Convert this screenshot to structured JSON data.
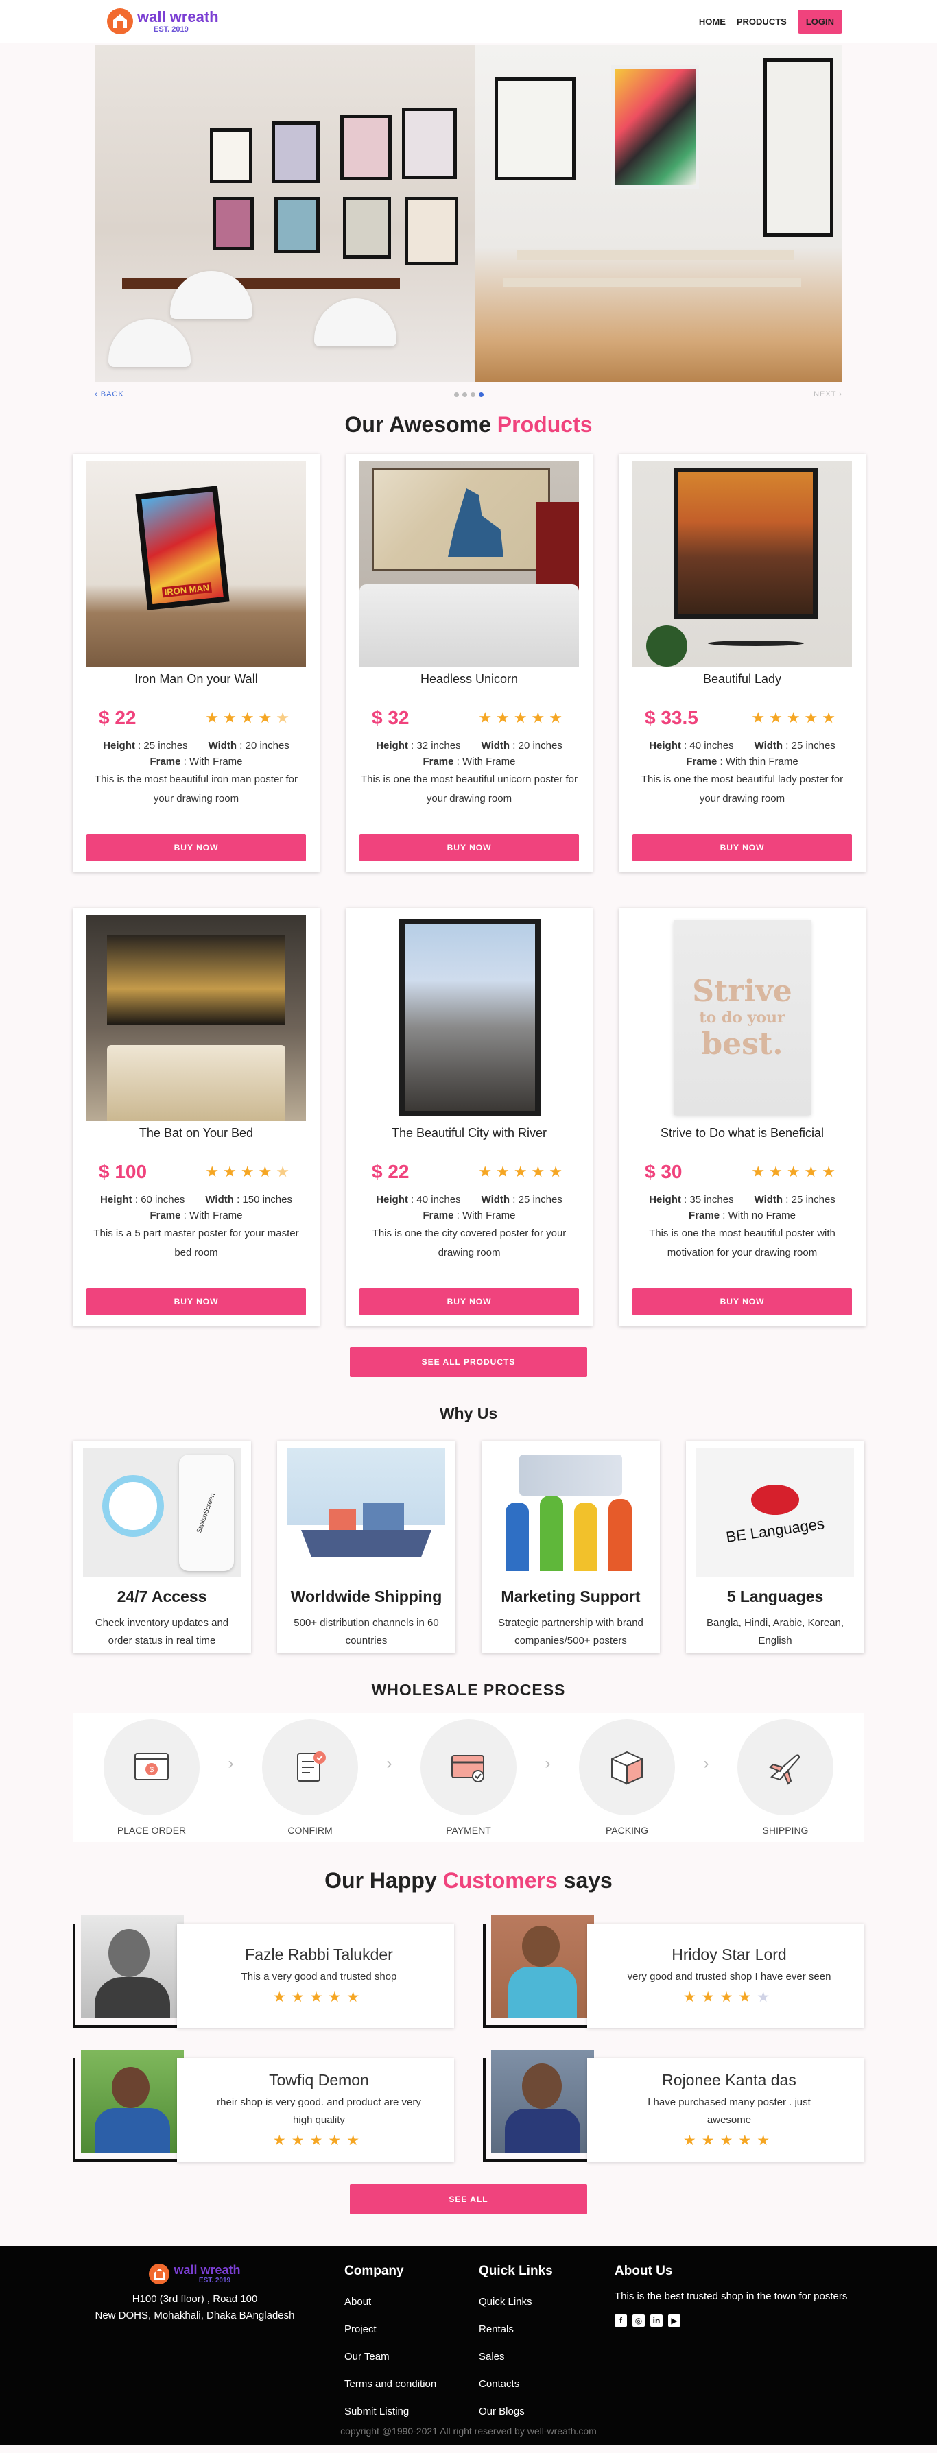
{
  "nav": {
    "brand": "wall wreath",
    "est": "EST. 2019",
    "links": [
      "HOME",
      "PRODUCTS"
    ],
    "login": "LOGIN"
  },
  "carousel": {
    "back": "BACK",
    "next": "NEXT",
    "slide_count": 4,
    "active_slide": 4
  },
  "products_section": {
    "title_plain": "Our Awesome",
    "title_accent": "Products",
    "see_all": "SEE ALL PRODUCTS"
  },
  "products": [
    {
      "name": "Iron Man On your Wall",
      "price": "$ 22",
      "rating": 4.5,
      "height_label": "Height",
      "height": ": 25 inches",
      "width_label": "Width",
      "width": ": 20 inches",
      "frame_label": "Frame",
      "frame": ": With Frame",
      "desc": "This is the most beautiful iron man poster for your drawing room",
      "buy": "BUY NOW"
    },
    {
      "name": "Headless Unicorn",
      "price": "$ 32",
      "rating": 5,
      "height_label": "Height",
      "height": ": 32 inches",
      "width_label": "Width",
      "width": ": 20 inches",
      "frame_label": "Frame",
      "frame": ": With Frame",
      "desc": "This is one the most beautiful unicorn poster for your drawing room",
      "buy": "BUY NOW"
    },
    {
      "name": "Beautiful Lady",
      "price": "$ 33.5",
      "rating": 5,
      "height_label": "Height",
      "height": ": 40 inches",
      "width_label": "Width",
      "width": ": 25 inches",
      "frame_label": "Frame",
      "frame": ": With thin Frame",
      "desc": "This is one the most beautiful lady poster for your drawing room",
      "buy": "BUY NOW"
    },
    {
      "name": "The Bat on Your Bed",
      "price": "$ 100",
      "rating": 4.5,
      "height_label": "Height",
      "height": ": 60 inches",
      "width_label": "Width",
      "width": ": 150 inches",
      "frame_label": "Frame",
      "frame": ": With Frame",
      "desc": "This is a 5 part master poster for your master bed room",
      "buy": "BUY NOW"
    },
    {
      "name": "The Beautiful City with River",
      "price": "$ 22",
      "rating": 5,
      "height_label": "Height",
      "height": ": 40 inches",
      "width_label": "Width",
      "width": ": 25 inches",
      "frame_label": "Frame",
      "frame": ": With Frame",
      "desc": "This is one the city covered poster for your drawing room",
      "buy": "BUY NOW"
    },
    {
      "name": "Strive to Do what is Beneficial",
      "price": "$ 30",
      "rating": 5,
      "height_label": "Height",
      "height": ": 35 inches",
      "width_label": "Width",
      "width": ": 25 inches",
      "frame_label": "Frame",
      "frame": ": With no Frame",
      "desc": "This is one the most beautiful poster with motivation for your drawing room",
      "buy": "BUY NOW"
    }
  ],
  "poster_text": {
    "strive_1": "Strive",
    "strive_2": "to do your",
    "strive_3": "best.",
    "iron_man": "IRON MAN",
    "be_languages": "BE Languages",
    "stylish_screen": "StylishScreen"
  },
  "why_us": {
    "title": "Why Us",
    "items": [
      {
        "title": "24/7 Access",
        "desc": "Check inventory updates and order status in real time"
      },
      {
        "title": "Worldwide Shipping",
        "desc": "500+ distribution channels in 60 countries"
      },
      {
        "title": "Marketing Support",
        "desc": "Strategic partnership with brand companies/500+ posters"
      },
      {
        "title": "5 Languages",
        "desc": "Bangla, Hindi, Arabic, Korean, English"
      }
    ]
  },
  "wholesale": {
    "title": "WHOLESALE PROCESS",
    "steps": [
      {
        "label": "PLACE ORDER",
        "icon": "browser-order-icon"
      },
      {
        "label": "CONFIRM",
        "icon": "checklist-icon"
      },
      {
        "label": "PAYMENT",
        "icon": "credit-card-icon"
      },
      {
        "label": "PACKING",
        "icon": "box-icon"
      },
      {
        "label": "SHIPPING",
        "icon": "airplane-icon"
      }
    ]
  },
  "testimonials": {
    "title_plain_1": "Our Happy",
    "title_accent": "Customers",
    "title_plain_2": "says",
    "see_all": "SEE ALL",
    "items": [
      {
        "name": "Fazle Rabbi Talukder",
        "quote": "This a very good and trusted shop",
        "rating": 5
      },
      {
        "name": "Hridoy Star Lord",
        "quote": "very good and trusted shop I have ever seen",
        "rating": 4
      },
      {
        "name": "Towfiq Demon",
        "quote": "rheir shop is very good. and product are very high quality",
        "rating": 5
      },
      {
        "name": "Rojonee Kanta das",
        "quote": "I have purchased many poster . just awesome",
        "rating": 5
      }
    ]
  },
  "footer": {
    "brand": "wall wreath",
    "est": "EST. 2019",
    "address_1": "H100 (3rd floor) , Road 100",
    "address_2": "New DOHS, Mohakhali, Dhaka BAngladesh",
    "company_title": "Company",
    "company_links": [
      "About",
      "Project",
      "Our Team",
      "Terms and condition",
      "Submit Listing"
    ],
    "quick_title": "Quick Links",
    "quick_links": [
      "Quick Links",
      "Rentals",
      "Sales",
      "Contacts",
      "Our Blogs"
    ],
    "about_title": "About Us",
    "about_text": "This is the best trusted shop in the town for posters",
    "copyright": "copyright @1990-2021 All right reserved by well-wreath.com"
  },
  "colors": {
    "accent": "#f0437d",
    "brand_purple": "#7b3fd3",
    "star": "#f5a623",
    "footer_bg": "#050505"
  }
}
